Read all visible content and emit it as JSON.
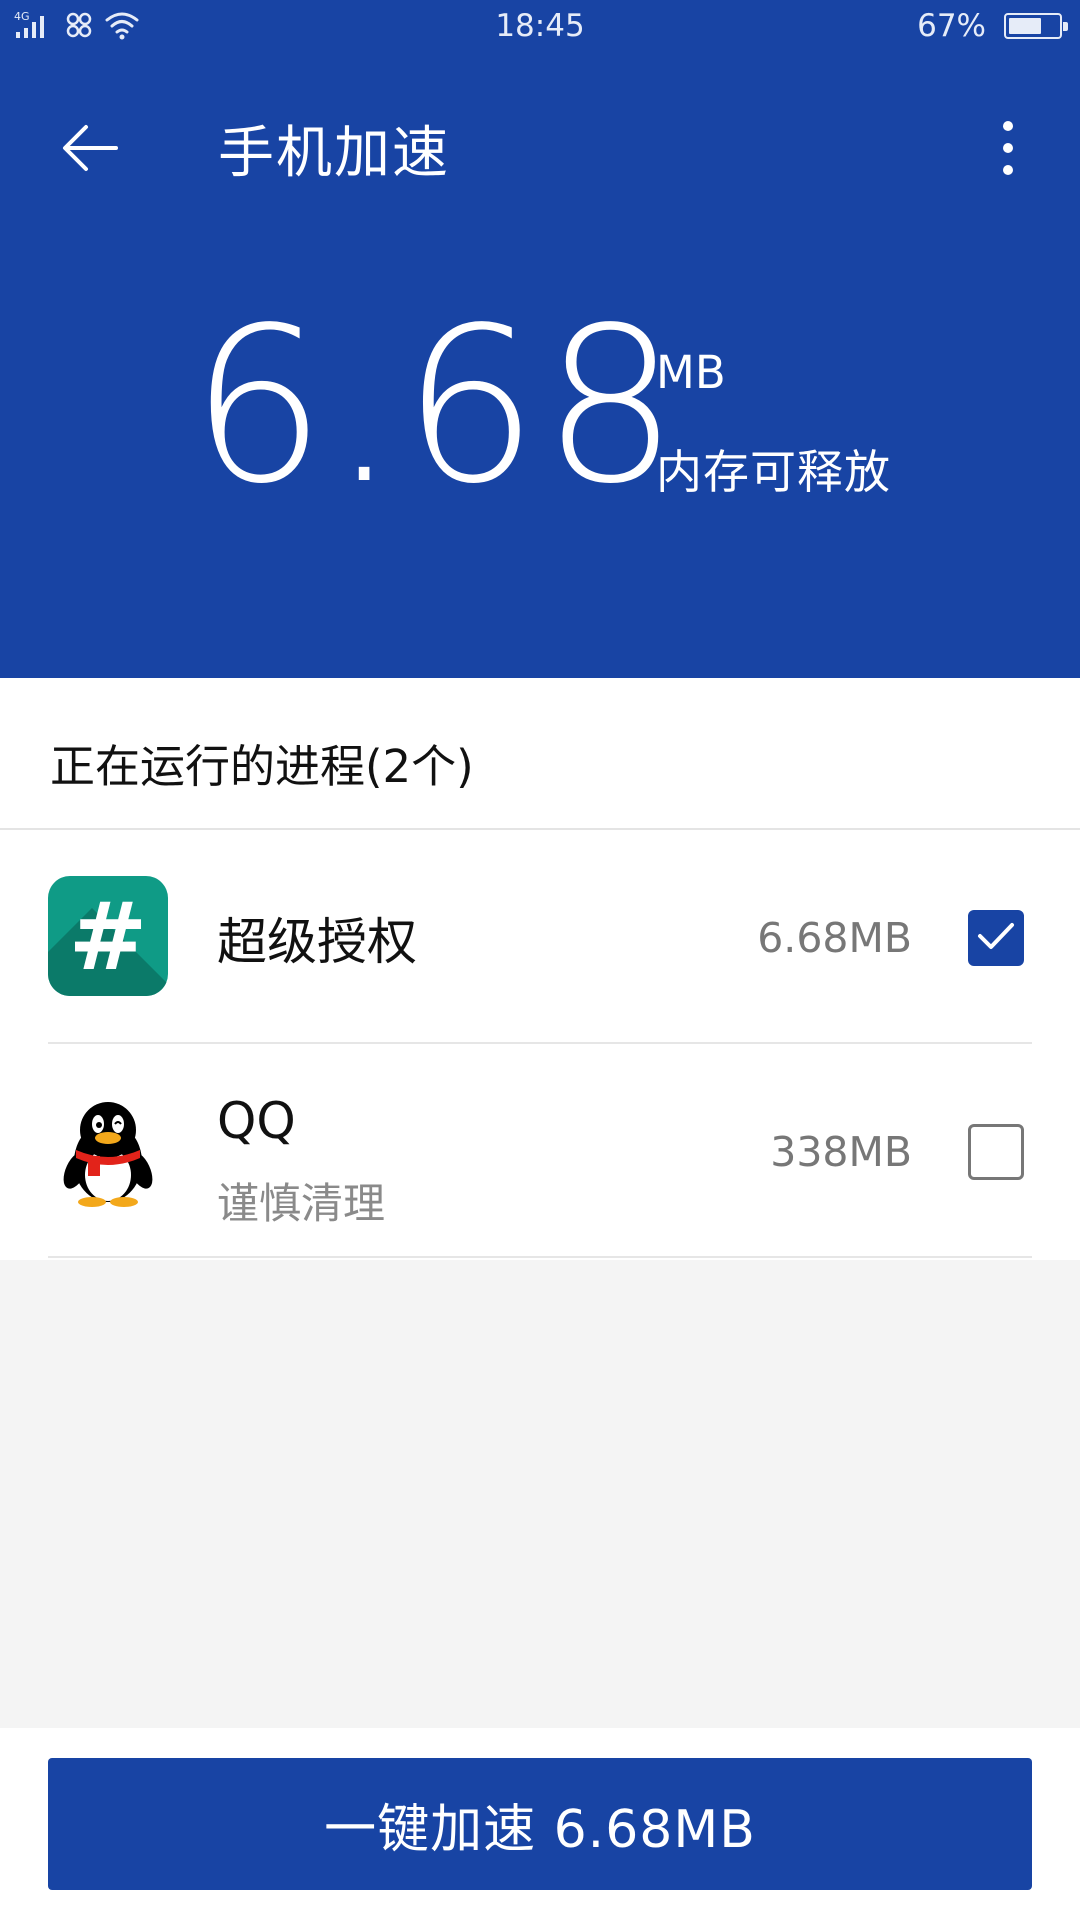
{
  "status_bar": {
    "network": "4G",
    "time": "18:45",
    "battery_percent_text": "67%",
    "battery_level": 0.67
  },
  "app_bar": {
    "back_icon": "arrow-left-icon",
    "title": "手机加速",
    "menu_icon": "more-vertical-icon"
  },
  "summary": {
    "amount": "6.68",
    "unit": "MB",
    "label": "内存可释放"
  },
  "processes": {
    "section_title": "正在运行的进程(2个)",
    "items": [
      {
        "name": "超级授权",
        "hint": "",
        "size": "6.68MB",
        "checked": true,
        "icon": "superuser-hash-icon"
      },
      {
        "name": "QQ",
        "hint": "谨慎清理",
        "size": "338MB",
        "checked": false,
        "icon": "qq-penguin-icon"
      }
    ]
  },
  "action": {
    "button_label": "一键加速 6.68MB"
  },
  "colors": {
    "primary": "#1844a4",
    "su_icon_bg": "#0f9b86",
    "background": "#f4f4f4"
  }
}
